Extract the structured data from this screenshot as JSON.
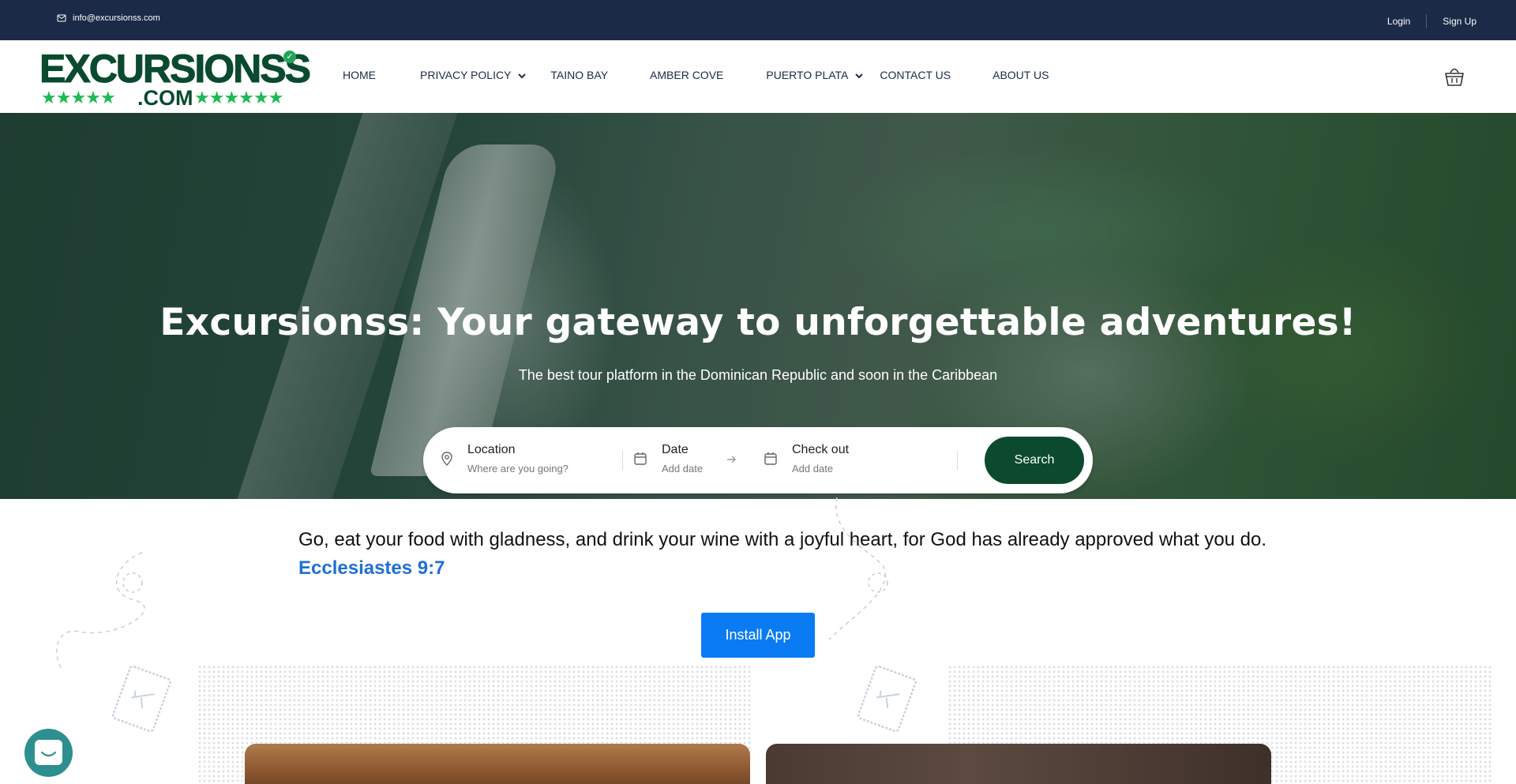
{
  "topbar": {
    "email": "info@excursionss.com",
    "login": "Login",
    "signup": "Sign Up"
  },
  "logo": {
    "word": "EXCURSIONSS",
    "dotcom": ".COM",
    "stars_left": "★★★★★",
    "stars_right": "★★★★★★",
    "check": "✓"
  },
  "nav": {
    "items": [
      {
        "label": "HOME"
      },
      {
        "label": "PRIVACY POLICY"
      },
      {
        "label": "TAINO BAY"
      },
      {
        "label": "AMBER COVE"
      },
      {
        "label": "PUERTO PLATA"
      },
      {
        "label": "CONTACT US"
      },
      {
        "label": "ABOUT US"
      }
    ]
  },
  "hero": {
    "title": "Excursionss: Your gateway to unforgettable adventures!",
    "subtitle": "The best tour platform in the Dominican Republic and soon in the Caribbean"
  },
  "search": {
    "location_label": "Location",
    "location_placeholder": "Where are you going?",
    "date_label": "Date",
    "date_placeholder": "Add date",
    "checkout_label": "Check out",
    "checkout_placeholder": "Add date",
    "button": "Search"
  },
  "quote": {
    "text": "Go, eat your food with gladness, and drink your wine with a joyful heart, for God has already approved what you do.",
    "reference": "Ecclesiastes 9:7"
  },
  "install_button": "Install App",
  "colors": {
    "topbar": "#1b2a47",
    "brand_green": "#0b4a2e",
    "star_green": "#1db954",
    "link_blue": "#1f6fd6",
    "install_blue": "#0a7bf2",
    "chat_teal": "#2d8f8f"
  },
  "icons": {
    "email": "mail-icon",
    "cart": "basket-icon",
    "location": "map-pin-icon",
    "date": "calendar-icon",
    "arrow": "arrow-right-icon",
    "chat": "chat-widget-icon"
  }
}
